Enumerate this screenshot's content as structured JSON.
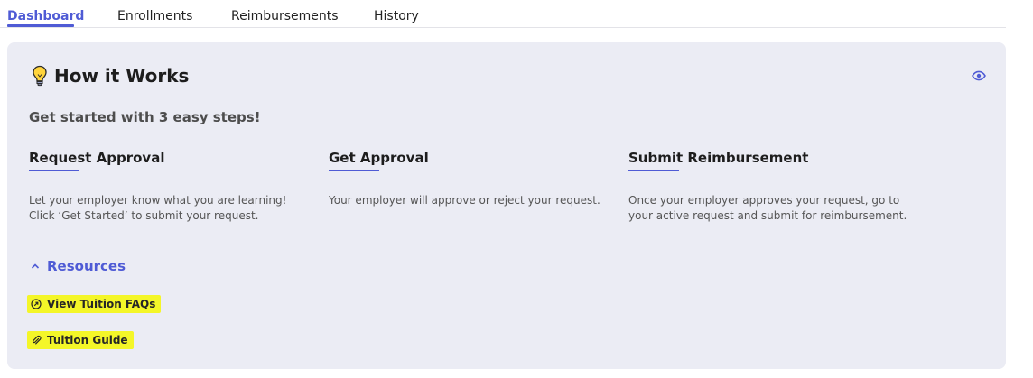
{
  "tabs": [
    {
      "label": "Dashboard",
      "active": true
    },
    {
      "label": "Enrollments",
      "active": false
    },
    {
      "label": "Reimbursements",
      "active": false
    },
    {
      "label": "History",
      "active": false
    }
  ],
  "card": {
    "title": "How it Works",
    "subtitle": "Get started with 3 easy steps!",
    "steps": [
      {
        "title": "Request Approval",
        "text": "Let your employer know what you are learning! Click ‘Get Started’ to submit your request."
      },
      {
        "title": "Get Approval",
        "text": "Your employer will approve or reject your request."
      },
      {
        "title": "Submit Reimbursement",
        "text": "Once your employer approves your request, go to your active request and submit for reimbursement."
      }
    ],
    "resources": {
      "label": "Resources",
      "links": [
        {
          "label": "View Tuition FAQs",
          "icon": "external-link-icon"
        },
        {
          "label": "Tuition Guide",
          "icon": "paperclip-icon"
        }
      ]
    }
  },
  "icons": {
    "title": "lightbulb-icon",
    "toggle": "eye-icon",
    "collapse": "chevron-up-icon"
  },
  "colors": {
    "accent": "#4f5bd5",
    "card_bg": "#ebecf4",
    "highlight": "#f4f628"
  }
}
